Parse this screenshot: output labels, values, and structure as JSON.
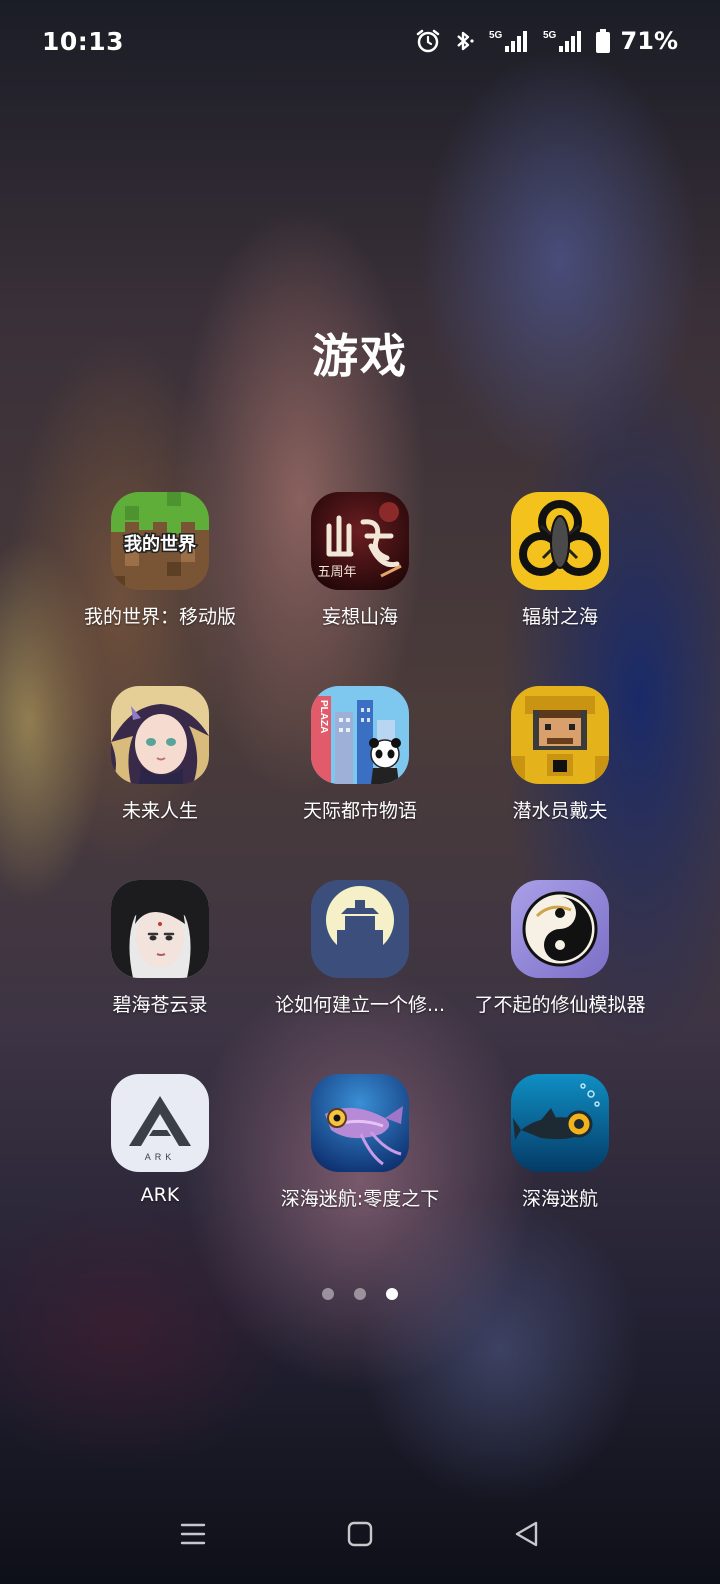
{
  "status_bar": {
    "time": "10:13",
    "battery_percent": "71%",
    "icons": [
      "alarm-icon",
      "bluetooth-icon",
      "signal-5g-icon",
      "signal-5g-icon",
      "battery-icon"
    ],
    "signal_labels": [
      "5G",
      "5G"
    ]
  },
  "folder": {
    "title": "游戏"
  },
  "apps": [
    {
      "label": "我的世界：移动版",
      "icon": "minecraft-icon",
      "icon_text": "我的世界"
    },
    {
      "label": "妄想山海",
      "icon": "shanhai-icon",
      "icon_text": "五周年"
    },
    {
      "label": "辐射之海",
      "icon": "biohazard-icon"
    },
    {
      "label": "未来人生",
      "icon": "anime-girl-icon"
    },
    {
      "label": "天际都市物语",
      "icon": "city-panda-icon",
      "icon_text": "PLAZA"
    },
    {
      "label": "潜水员戴夫",
      "icon": "diver-dave-icon"
    },
    {
      "label": "碧海苍云录",
      "icon": "ink-character-icon"
    },
    {
      "label": "论如何建立一个修...",
      "icon": "moon-palace-icon"
    },
    {
      "label": "了不起的修仙模拟器",
      "icon": "taiji-icon"
    },
    {
      "label": "ARK",
      "icon": "ark-logo-icon",
      "icon_text": "ARK"
    },
    {
      "label": "深海迷航:零度之下",
      "icon": "below-zero-fish-icon"
    },
    {
      "label": "深海迷航",
      "icon": "subnautica-fish-icon"
    }
  ],
  "pagination": {
    "total": 3,
    "active": 3
  },
  "nav_bar": [
    "menu-icon",
    "home-icon",
    "back-icon"
  ]
}
